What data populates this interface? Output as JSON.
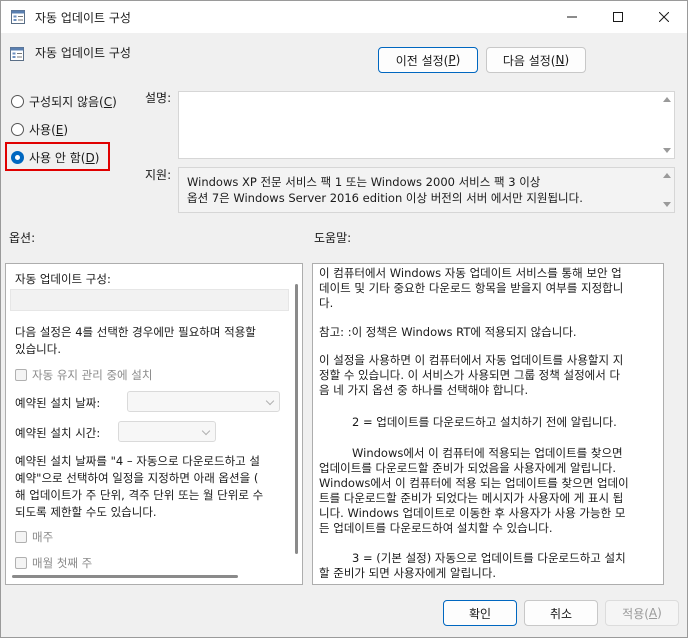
{
  "window": {
    "title": "자동 업데이트 구성"
  },
  "header": {
    "policy_name": "자동 업데이트 구성"
  },
  "nav": {
    "prev_label": "이전 설정(",
    "prev_key": "P",
    "next_label": "다음 설정(",
    "next_key": "N"
  },
  "state": {
    "not_configured": "구성되지 않음(",
    "not_configured_key": "C",
    "enabled": "사용(",
    "enabled_key": "E",
    "disabled": "사용 안 함(",
    "disabled_key": "D",
    "close_paren": ")",
    "selected": "disabled"
  },
  "comment": {
    "label": "설명:",
    "value": ""
  },
  "support": {
    "label": "지원:",
    "line1": "Windows XP 전문 서비스 팩 1 또는 Windows 2000 서비스 팩 3 이상",
    "line2": "옵션 7은 Windows Server 2016 edition 이상 버전의 서버 에서만 지원됩니다."
  },
  "options": {
    "label": "옵션:",
    "title": "자동 업데이트 구성:",
    "note1": "다음 설정은 4를 선택한 경우에만 필요하며 적용할",
    "note2": "있습니다.",
    "maintenance": "자동 유지 관리 중에 설치",
    "install_day": "예약된 설치 날짜:",
    "install_time": "예약된 설치 시간:",
    "desc1": "예약된 설치 날짜를 \"4 – 자동으로 다운로드하고 설",
    "desc2": "예약\"으로 선택하여 일정을 지정하면 아래 옵션을 (",
    "desc3": "해 업데이트가 주 단위, 격주 단위 또는 월 단위로 수",
    "desc4": "되도록 제한할 수도 있습니다.",
    "weekly": "매주",
    "first_week": "매월 첫째 주"
  },
  "help": {
    "label": "도움말:",
    "p1a": "이 컴퓨터에서 Windows 자동 업데이트 서비스를 통해 보안 업",
    "p1b": "데이트 및 기타 중요한 다운로드 항목을 받을지 여부를 지정합니",
    "p1c": "다.",
    "p2": "참고: :이 정책은 Windows RT에 적용되지 않습니다.",
    "p3a": "이 설정을 사용하면 이 컴퓨터에서 자동 업데이트를 사용할지 지",
    "p3b": "정할 수 있습니다. 이 서비스가 사용되면 그룹 정책 설정에서 다",
    "p3c": "음 네 가지 옵션 중 하나를 선택해야 합니다.",
    "p4": "2 = 업데이트를 다운로드하고 설치하기 전에 알립니다.",
    "p5a": "Windows에서 이 컴퓨터에 적용되는 업데이트를 찾으면",
    "p5b": "업데이트를 다운로드할 준비가 되었음을 사용자에게 알립니다.",
    "p5c": "Windows에서 이 컴퓨터에 적용 되는 업데이트를 찾으면 업데이",
    "p5d": "트를 다운로드할 준비가 되었다는 메시지가 사용자에 게 표시 됩",
    "p5e": "니다. Windows 업데이트로 이동한 후 사용자가 사용 가능한 모",
    "p5f": "든 업데이트를 다운로드하여 설치할 수 있습니다.",
    "p6a": "3 = (기본 설정) 자동으로 업데이트를 다운로드하고 설치",
    "p6b": "할 준비가 되면 사용자에게 알립니다."
  },
  "footer": {
    "ok": "확인",
    "cancel": "취소",
    "apply": "적용(",
    "apply_key": "A",
    "close_paren": ")"
  }
}
